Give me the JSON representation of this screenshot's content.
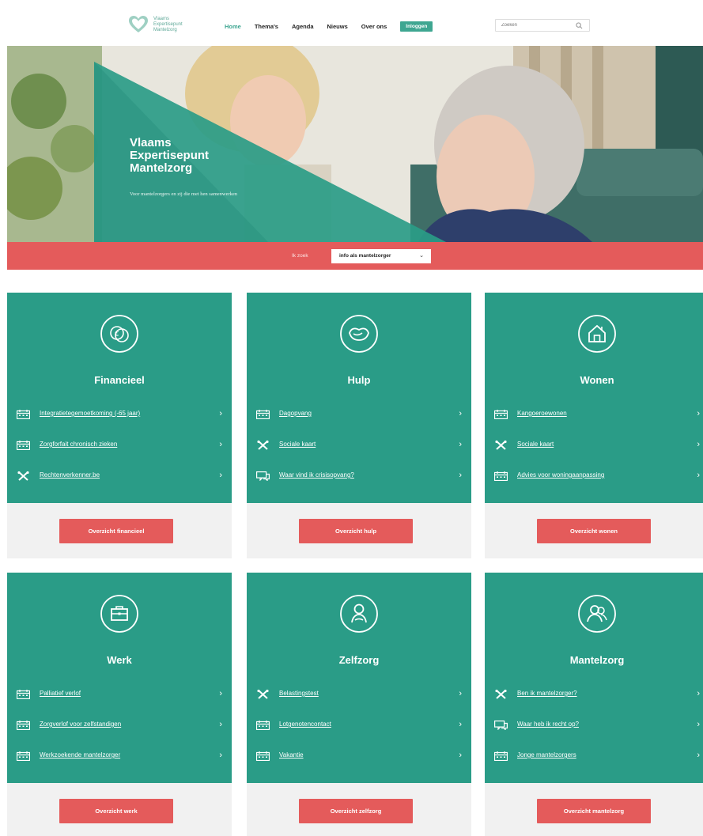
{
  "header": {
    "logo_lines": [
      "Vlaams",
      "Expertisepunt",
      "Mantelzorg"
    ],
    "nav": [
      {
        "label": "Home",
        "active": true
      },
      {
        "label": "Thema's",
        "active": false
      },
      {
        "label": "Agenda",
        "active": false
      },
      {
        "label": "Nieuws",
        "active": false
      },
      {
        "label": "Over ons",
        "active": false
      }
    ],
    "cta_label": "Inloggen",
    "search_placeholder": "Zoeken",
    "search_icon": "search-icon"
  },
  "hero": {
    "title_lines": [
      "Vlaams",
      "Expertisepunt",
      "Mantelzorg"
    ],
    "subtitle": "Voor mantelzorgers en zij die met hen samenwerken"
  },
  "ikzoek": {
    "label": "Ik zoek",
    "selected": "info als mantelzorger",
    "chevron_icon": "chevron-down-icon"
  },
  "cards": [
    {
      "title": "Financieel",
      "icon": "euro-coins-icon",
      "links": [
        {
          "icon": "calendar-icon",
          "label": "Integratietegemoetkoming (-65 jaar)"
        },
        {
          "icon": "calendar-icon",
          "label": "Zorgforfait chronisch zieken"
        },
        {
          "icon": "tools-icon",
          "label": "Rechtenverkenner.be"
        }
      ],
      "button": "Overzicht financieel"
    },
    {
      "title": "Hulp",
      "icon": "handshake-icon",
      "links": [
        {
          "icon": "calendar-icon",
          "label": "Dagopvang"
        },
        {
          "icon": "tools-icon",
          "label": "Sociale kaart"
        },
        {
          "icon": "chat-icon",
          "label": "Waar vind ik crisisopvang?"
        }
      ],
      "button": "Overzicht hulp"
    },
    {
      "title": "Wonen",
      "icon": "house-icon",
      "links": [
        {
          "icon": "calendar-icon",
          "label": "Kangoeroewonen"
        },
        {
          "icon": "tools-icon",
          "label": "Sociale kaart"
        },
        {
          "icon": "calendar-icon",
          "label": "Advies voor woningaanpassing"
        }
      ],
      "button": "Overzicht wonen"
    },
    {
      "title": "Werk",
      "icon": "briefcase-icon",
      "links": [
        {
          "icon": "calendar-icon",
          "label": "Palliatief verlof"
        },
        {
          "icon": "calendar-icon",
          "label": "Zorgverlof voor zelfstandigen"
        },
        {
          "icon": "calendar-icon",
          "label": "Werkzoekende mantelzorger"
        }
      ],
      "button": "Overzicht werk"
    },
    {
      "title": "Zelfzorg",
      "icon": "person-care-icon",
      "links": [
        {
          "icon": "tools-icon",
          "label": "Belastingstest"
        },
        {
          "icon": "calendar-icon",
          "label": "Lotgenotencontact"
        },
        {
          "icon": "calendar-icon",
          "label": "Vakantie"
        }
      ],
      "button": "Overzicht zelfzorg"
    },
    {
      "title": "Mantelzorg",
      "icon": "people-icon",
      "links": [
        {
          "icon": "tools-icon",
          "label": "Ben ik mantelzorger?"
        },
        {
          "icon": "chat-icon",
          "label": "Waar heb ik recht op?"
        },
        {
          "icon": "calendar-icon",
          "label": "Jonge mantelzorgers"
        }
      ],
      "button": "Overzicht mantelzorg"
    }
  ],
  "colors": {
    "teal": "#2a9c87",
    "red": "#e45b5b",
    "light_grey": "#f1f1f1"
  }
}
